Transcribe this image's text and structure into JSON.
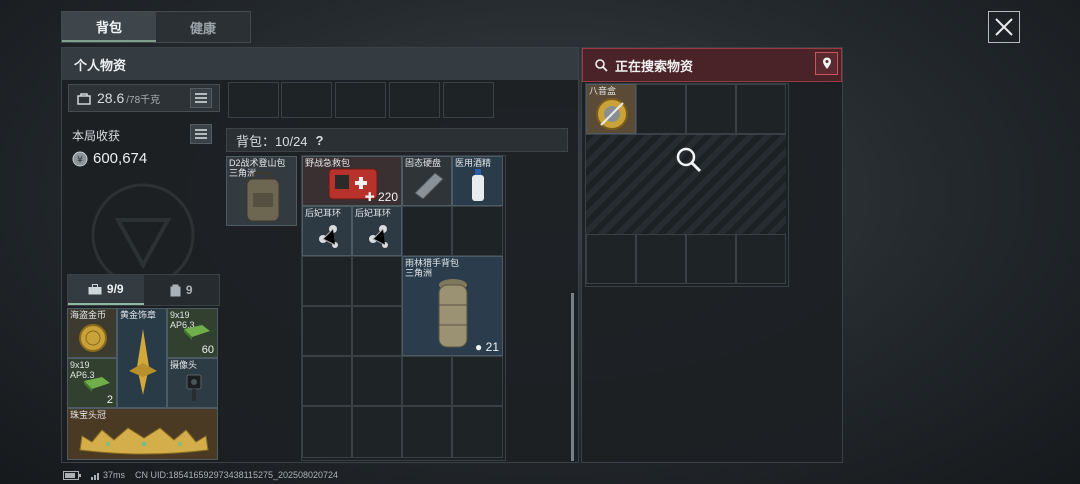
{
  "tabs": [
    {
      "label": "背包"
    },
    {
      "label": "健康"
    }
  ],
  "left_panel": {
    "title": "个人物资",
    "weight_value": "28.6",
    "weight_max": "/78千克",
    "earnings_label": "本局收获",
    "earnings_value": "600,674",
    "subtabs": [
      {
        "label": "9/9"
      },
      {
        "label": "9"
      }
    ],
    "items": [
      {
        "label": "海盗金币",
        "qty": ""
      },
      {
        "label": "黄金饰章",
        "qty": ""
      },
      {
        "label": "9x19 AP6.3",
        "qty": "60"
      },
      {
        "label": "9x19 AP6.3",
        "qty": "2"
      },
      {
        "label": "摄像头",
        "qty": ""
      },
      {
        "label": "珠宝头冠",
        "qty": ""
      }
    ]
  },
  "backpack": {
    "label": "背包：10/24",
    "help": "?",
    "bag_label": "D2战术登山包 三角洲",
    "items": [
      {
        "label": "野战急救包",
        "qty": "220"
      },
      {
        "label": "固态硬盘",
        "qty": ""
      },
      {
        "label": "医用酒精",
        "qty": ""
      },
      {
        "label": "后妃耳环",
        "qty": ""
      },
      {
        "label": "后妃耳环",
        "qty": ""
      },
      {
        "label": "雨林猎手背包 三角洲",
        "qty": "21"
      }
    ]
  },
  "search_panel": {
    "title": "正在搜索物资",
    "item_label": "八音盒"
  },
  "status_bar": {
    "ping": "37ms",
    "uid": "CN UID:185416592973438115275_202508020724"
  },
  "colors": {
    "accent": "#7fa08a",
    "search_red": "#9b3a42",
    "gold": "#c9a23a"
  }
}
